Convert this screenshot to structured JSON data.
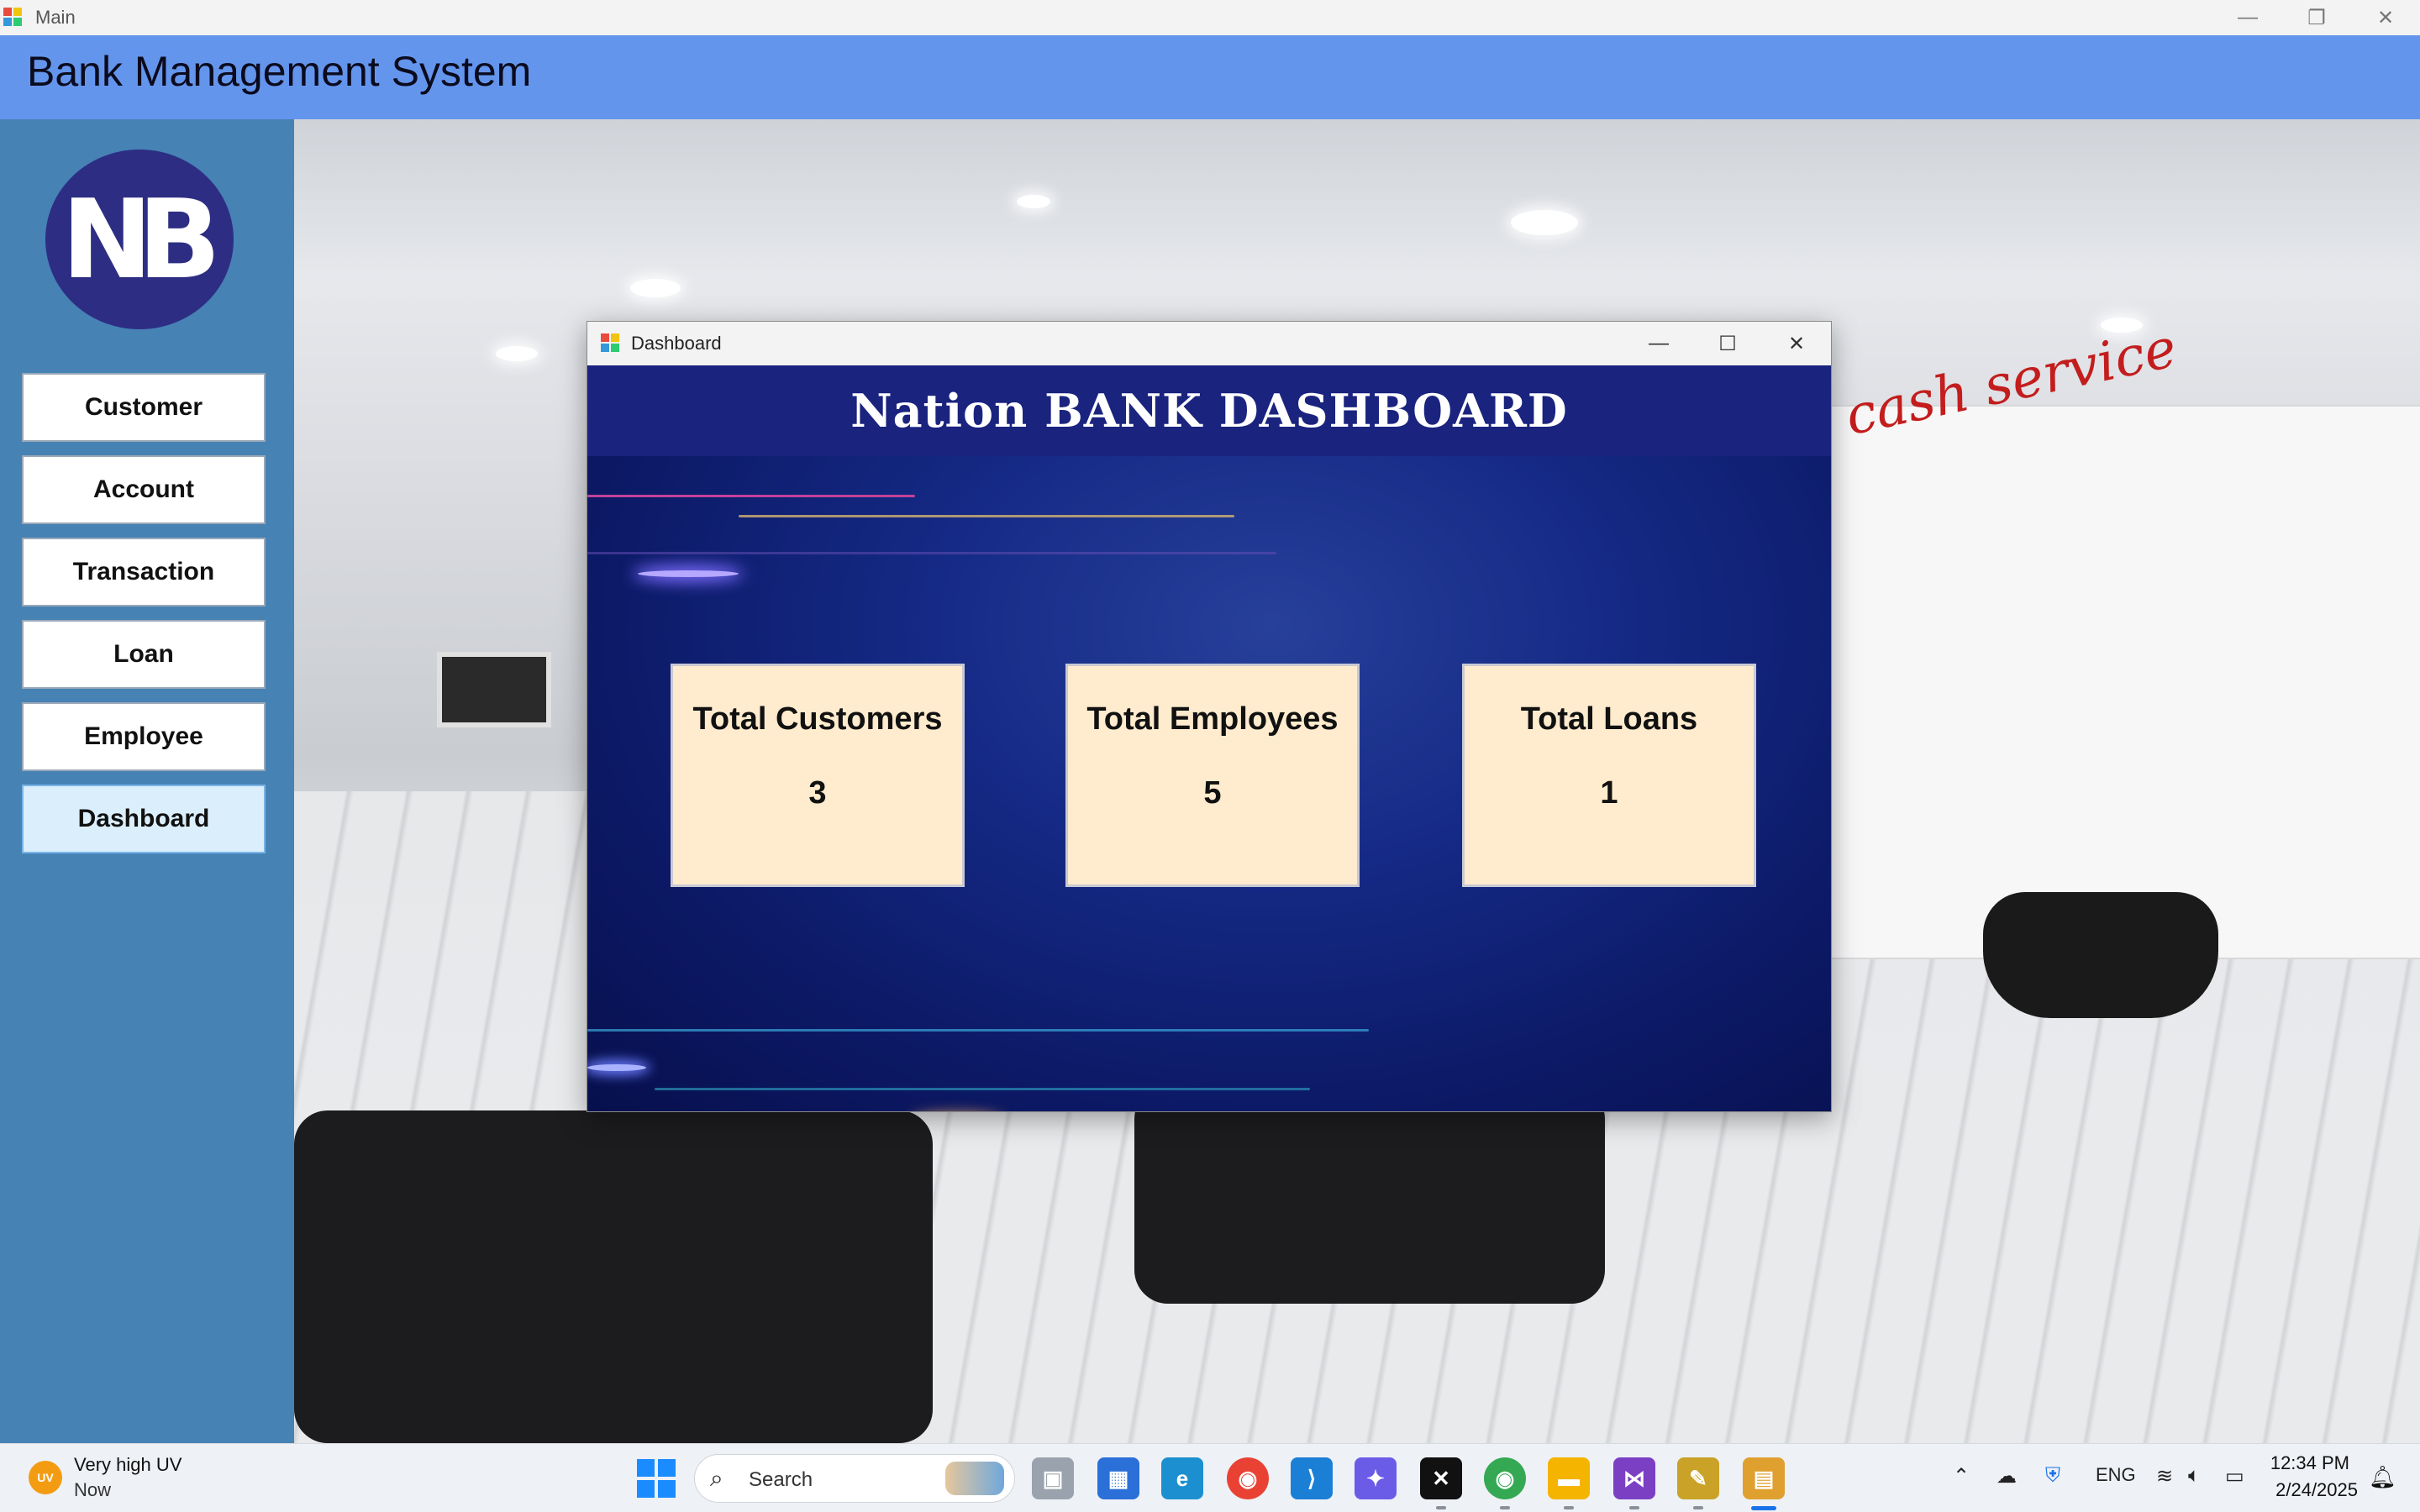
{
  "main_window": {
    "title": "Main",
    "minimize": "—",
    "restore": "❐",
    "close": "✕"
  },
  "header": {
    "title": "Bank Management System"
  },
  "sidebar": {
    "logo_text": "NB",
    "items": [
      {
        "label": "Customer"
      },
      {
        "label": "Account"
      },
      {
        "label": "Transaction"
      },
      {
        "label": "Loan"
      },
      {
        "label": "Employee"
      },
      {
        "label": "Dashboard",
        "active": true
      }
    ]
  },
  "dashboard_window": {
    "title": "Dashboard",
    "minimize": "—",
    "maximize": "☐",
    "close": "✕",
    "header_title": "Nation BANK DASHBOARD",
    "stats": [
      {
        "label": "Total Customers",
        "value": "3"
      },
      {
        "label": "Total Employees",
        "value": "5"
      },
      {
        "label": "Total Loans",
        "value": "1"
      }
    ]
  },
  "background": {
    "sign_text": "cash service"
  },
  "taskbar": {
    "weather": {
      "badge": "UV",
      "title": "Very high UV",
      "subtitle": "Now"
    },
    "search_label": "Search",
    "tray_language": "ENG",
    "time": "12:34 PM",
    "date": "2/24/2025"
  },
  "colors": {
    "header": "#6495ed",
    "sidebar": "#4682b4",
    "card": "#ffebcd",
    "dashboard_bg": "#0b1a6d",
    "logo": "#2d2e83"
  }
}
